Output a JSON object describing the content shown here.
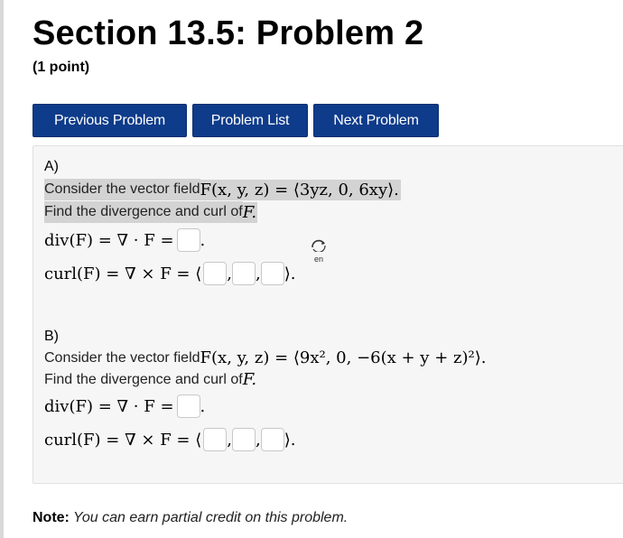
{
  "page": {
    "title": "Section 13.5: Problem 2",
    "points": "(1 point)"
  },
  "nav": {
    "previous": "Previous Problem",
    "list": "Problem List",
    "next": "Next Problem"
  },
  "colors": {
    "button_bg": "#0e3b8a",
    "problem_bg": "#f6f6f6",
    "highlight": "#d3d3d3"
  },
  "partA": {
    "label": "A)",
    "prompt": "Consider the vector field ",
    "field_math": "F(x, y, z) = ⟨3yz, 0, 6xy⟩.",
    "find_prefix": "Find the divergence and curl of ",
    "find_F": "F.",
    "div_expr": "div(F) = ∇ · F =",
    "curl_expr": "curl(F) = ∇ × F = ⟨",
    "lang_icon": "en"
  },
  "partB": {
    "label": "B)",
    "prompt": "Consider the vector field ",
    "field_math": "F(x, y, z) = ⟨9x², 0, −6(x + y + z)²⟩.",
    "find_prefix": "Find the divergence and curl of ",
    "find_F": "F.",
    "div_expr": "div(F) = ∇ · F =",
    "curl_expr": "curl(F) = ∇ × F = ⟨"
  },
  "note": {
    "label": "Note:",
    "text": " You can earn partial credit on this problem."
  }
}
